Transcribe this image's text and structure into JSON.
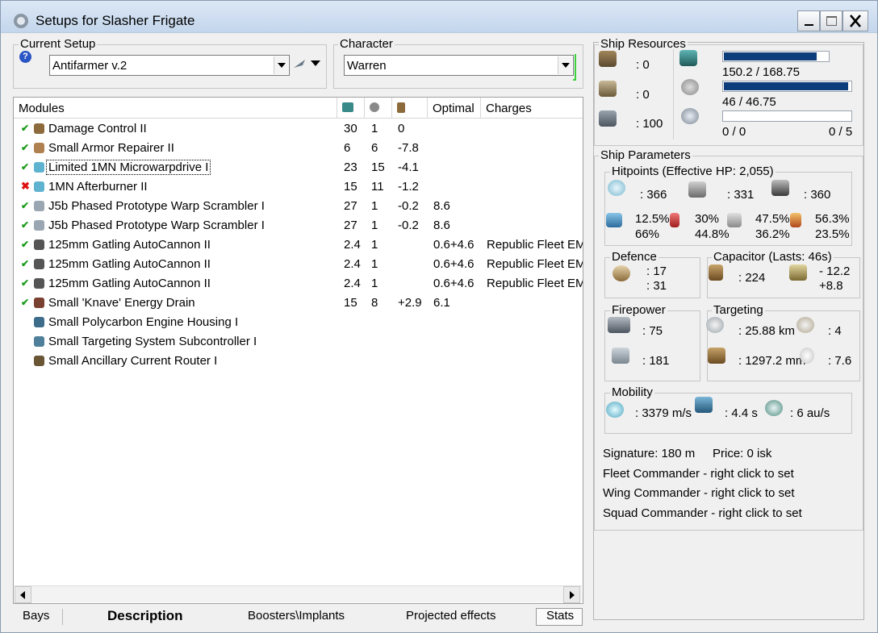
{
  "window": {
    "title": "Setups for Slasher Frigate"
  },
  "current_setup": {
    "label": "Current Setup",
    "value": "Antifarmer v.2"
  },
  "character": {
    "label": "Character",
    "value": "Warren"
  },
  "modules_table": {
    "columns": [
      "Modules",
      "",
      "",
      "",
      "Optimal",
      "Charges"
    ],
    "rows": [
      {
        "status": "check",
        "name": "Damage Control II",
        "cpu": "30",
        "pg": "1",
        "cap": "0",
        "optimal": "",
        "charges": ""
      },
      {
        "status": "check",
        "name": "Small Armor Repairer II",
        "cpu": "6",
        "pg": "6",
        "cap": "-7.8",
        "optimal": "",
        "charges": ""
      },
      {
        "status": "check",
        "name": "Limited 1MN Microwarpdrive I",
        "cpu": "23",
        "pg": "15",
        "cap": "-4.1",
        "optimal": "",
        "charges": ""
      },
      {
        "status": "cross",
        "name": "1MN Afterburner II",
        "cpu": "15",
        "pg": "11",
        "cap": "-1.2",
        "optimal": "",
        "charges": ""
      },
      {
        "status": "check",
        "name": "J5b Phased Prototype Warp Scrambler I",
        "cpu": "27",
        "pg": "1",
        "cap": "-0.2",
        "optimal": "8.6",
        "charges": ""
      },
      {
        "status": "check",
        "name": "J5b Phased Prototype Warp Scrambler I",
        "cpu": "27",
        "pg": "1",
        "cap": "-0.2",
        "optimal": "8.6",
        "charges": ""
      },
      {
        "status": "check",
        "name": "125mm Gatling AutoCannon II",
        "cpu": "2.4",
        "pg": "1",
        "cap": "",
        "optimal": "0.6+4.6",
        "charges": "Republic Fleet EM"
      },
      {
        "status": "check",
        "name": "125mm Gatling AutoCannon II",
        "cpu": "2.4",
        "pg": "1",
        "cap": "",
        "optimal": "0.6+4.6",
        "charges": "Republic Fleet EM"
      },
      {
        "status": "check",
        "name": "125mm Gatling AutoCannon II",
        "cpu": "2.4",
        "pg": "1",
        "cap": "",
        "optimal": "0.6+4.6",
        "charges": "Republic Fleet EM"
      },
      {
        "status": "check",
        "name": "Small 'Knave' Energy Drain",
        "cpu": "15",
        "pg": "8",
        "cap": "+2.9",
        "optimal": "6.1",
        "charges": ""
      },
      {
        "status": "",
        "name": "Small Polycarbon Engine Housing I",
        "cpu": "",
        "pg": "",
        "cap": "",
        "optimal": "",
        "charges": ""
      },
      {
        "status": "",
        "name": "Small Targeting System Subcontroller I",
        "cpu": "",
        "pg": "",
        "cap": "",
        "optimal": "",
        "charges": ""
      },
      {
        "status": "",
        "name": "Small Ancillary Current Router I",
        "cpu": "",
        "pg": "",
        "cap": "",
        "optimal": "",
        "charges": ""
      }
    ]
  },
  "tabs": [
    "Bays",
    "Description",
    "Boosters\\Implants",
    "Projected effects",
    "Stats"
  ],
  "ship_resources": {
    "label": "Ship Resources",
    "turret": ": 0",
    "launcher": ": 0",
    "drone_bay": ": 100",
    "cpu": "150.2 / 168.75",
    "cpu_fraction": 0.89,
    "powergrid": "46 / 46.75",
    "powergrid_fraction": 0.98,
    "drone_left": "0 / 0",
    "drone_right": "0 / 5"
  },
  "ship_parameters": {
    "label": "Ship Parameters",
    "hitpoints": {
      "label": "Hitpoints (Effective HP: 2,055)",
      "shield": ": 366",
      "armor": ": 331",
      "structure": ": 360",
      "res": [
        [
          "12.5%",
          "66%"
        ],
        [
          "30%",
          "44.8%"
        ],
        [
          "47.5%",
          "36.2%"
        ],
        [
          "56.3%",
          "23.5%"
        ]
      ]
    },
    "defence": {
      "label": "Defence",
      "a": ": 17",
      "b": ": 31"
    },
    "capacitor": {
      "label": "Capacitor (Lasts: 46s)",
      "amount": ": 224",
      "a": "- 12.2",
      "b": "+8.8"
    },
    "firepower": {
      "label": "Firepower",
      "a": ": 75",
      "b": ": 181"
    },
    "targeting": {
      "label": "Targeting",
      "range": ": 25.88 km",
      "targets": ": 4",
      "resolution": ": 1297.2 mm",
      "sensor": ": 7.6"
    },
    "mobility": {
      "label": "Mobility",
      "speed": ": 3379 m/s",
      "align": ": 4.4 s",
      "warp": ": 6 au/s"
    }
  },
  "info": {
    "signature": "Signature: 180 m",
    "price": "Price: 0 isk",
    "fleet": "Fleet Commander - right click to set",
    "wing": "Wing Commander - right click to set",
    "squad": "Squad Commander - right click to set"
  }
}
